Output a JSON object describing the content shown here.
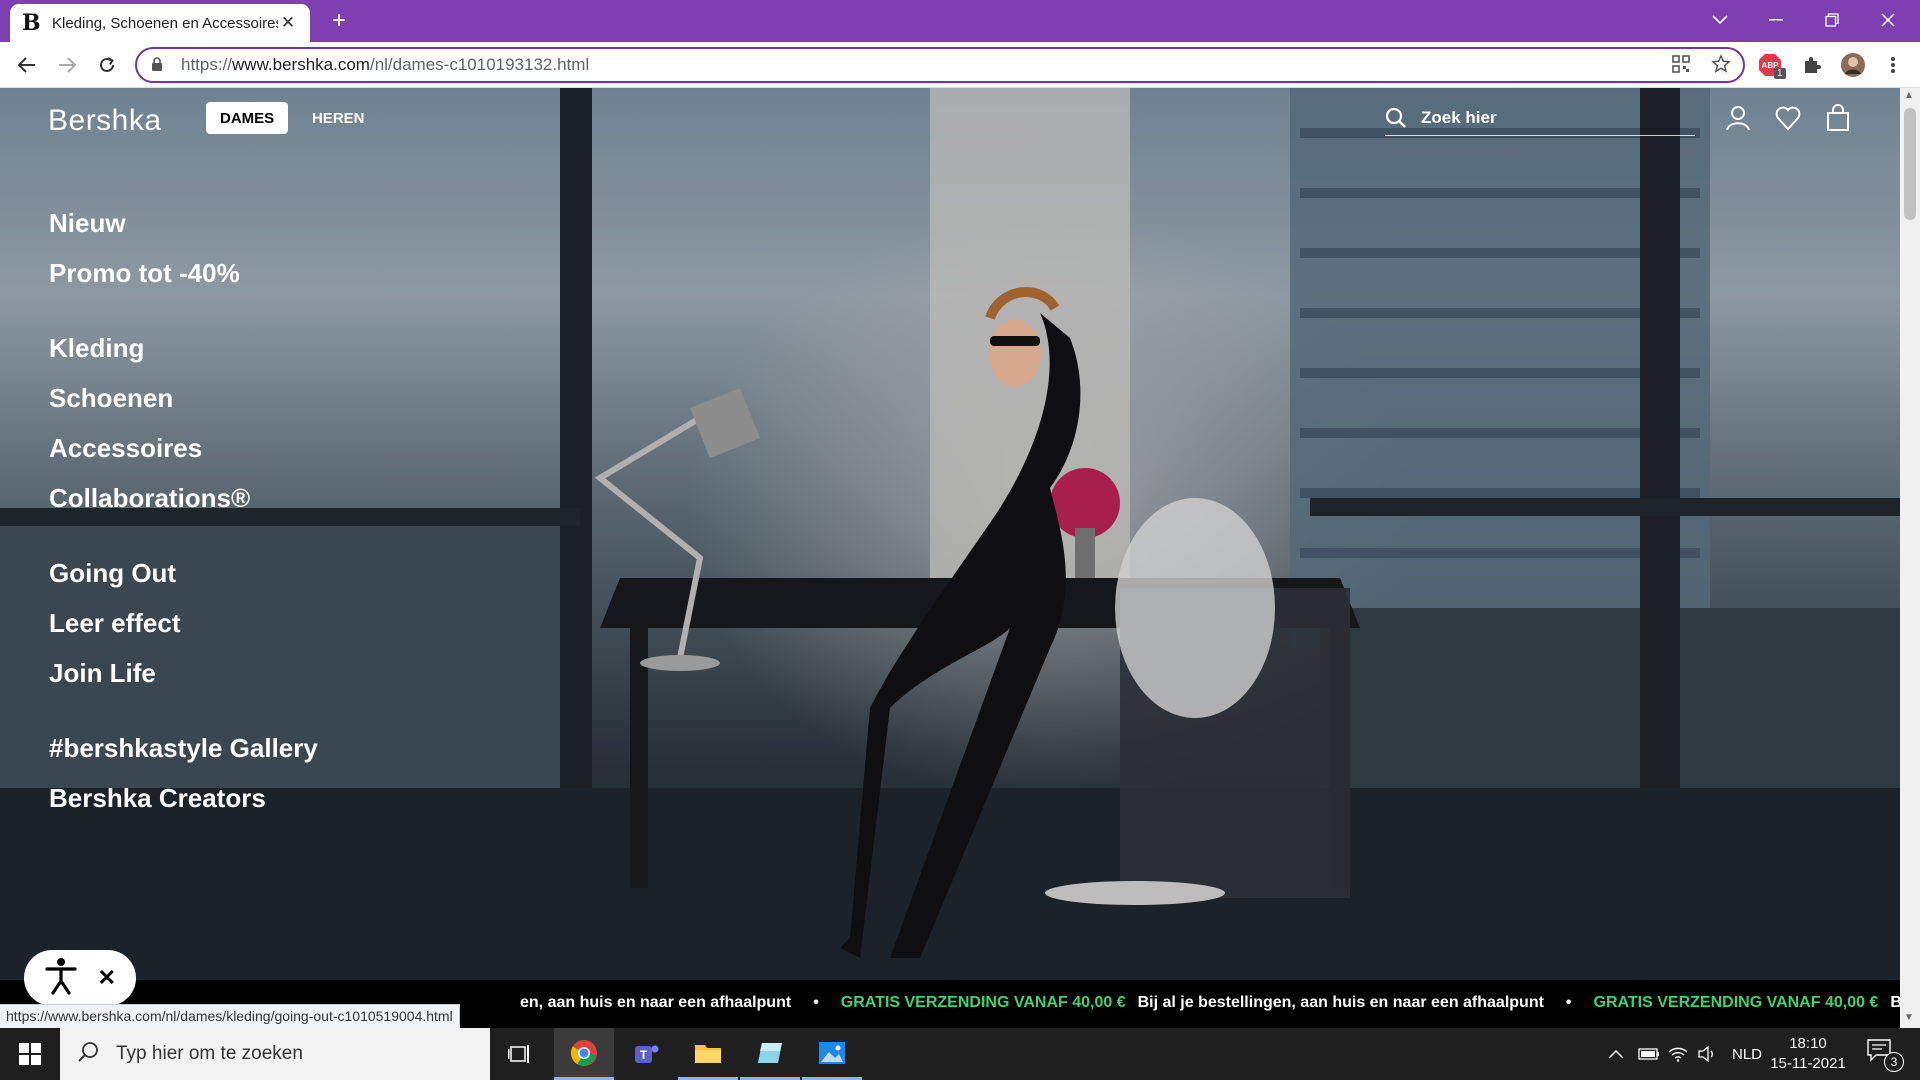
{
  "browser": {
    "tab_title": "Kleding, Schoenen en Accessoires",
    "tab_favicon": "B",
    "url_prefix": "https://",
    "url_domain": "www.bershka.com",
    "url_path": "/nl/dames-c1010193132.html",
    "extension_badge": "1",
    "status_url": "https://www.bershka.com/nl/dames/kleding/going-out-c1010519004.html"
  },
  "site": {
    "logo": "Bershka",
    "gender_tabs": [
      "DAMES",
      "HEREN"
    ],
    "search_placeholder": "Zoek hier",
    "menu_groups": [
      [
        "Nieuw",
        "Promo tot -40%"
      ],
      [
        "Kleding",
        "Schoenen",
        "Accessoires",
        "Collaborations®"
      ],
      [
        "Going Out",
        "Leer effect",
        "Join Life"
      ],
      [
        "#bershkastyle Gallery",
        "Bershka Creators"
      ]
    ],
    "ticker": {
      "highlight": "GRATIS VERZENDING VANAF 40,00 €",
      "text": "Bij al je bestellingen, aan huis en naar een afhaalpunt",
      "lead_fragment": "en, aan huis en naar een afhaalpunt",
      "tail_fragment": "Bij al je be"
    }
  },
  "taskbar": {
    "search_placeholder": "Typ hier om te zoeken",
    "language": "NLD",
    "time": "18:10",
    "date": "15-11-2021",
    "notification_count": "3"
  },
  "colors": {
    "tab_strip": "#7e3fb0",
    "omnibox_border": "#6d36a8",
    "ticker_highlight": "#3ed36f"
  }
}
